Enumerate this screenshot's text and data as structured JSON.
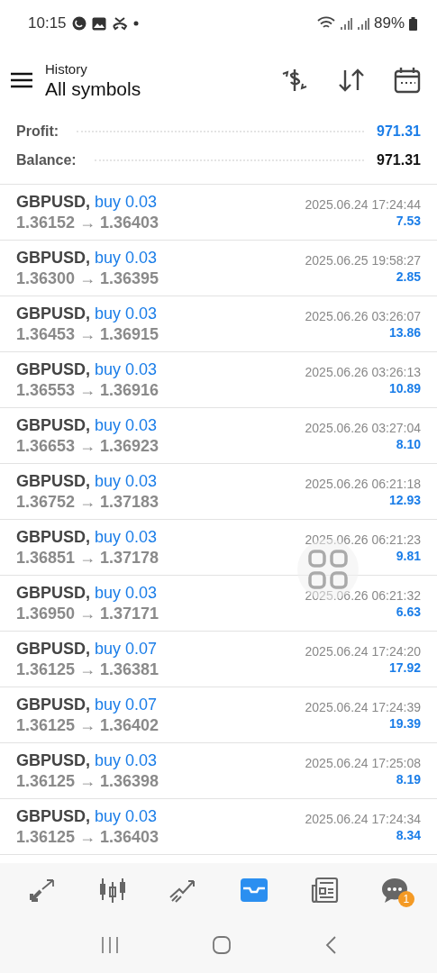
{
  "status_bar": {
    "time": "10:15",
    "battery": "89%"
  },
  "header": {
    "subtitle": "History",
    "title": "All symbols"
  },
  "summary": [
    {
      "label": "Profit:",
      "value": "971.31",
      "kind": "profit"
    },
    {
      "label": "Balance:",
      "value": "971.31",
      "kind": "balance"
    }
  ],
  "deals": [
    {
      "symbol": "GBPUSD,",
      "side": "buy 0.03",
      "prices": "1.36152 → 1.36403",
      "time": "2025.06.24 17:24:44",
      "profit": "7.53"
    },
    {
      "symbol": "GBPUSD,",
      "side": "buy 0.03",
      "prices": "1.36300 → 1.36395",
      "time": "2025.06.25 19:58:27",
      "profit": "2.85"
    },
    {
      "symbol": "GBPUSD,",
      "side": "buy 0.03",
      "prices": "1.36453 → 1.36915",
      "time": "2025.06.26 03:26:07",
      "profit": "13.86"
    },
    {
      "symbol": "GBPUSD,",
      "side": "buy 0.03",
      "prices": "1.36553 → 1.36916",
      "time": "2025.06.26 03:26:13",
      "profit": "10.89"
    },
    {
      "symbol": "GBPUSD,",
      "side": "buy 0.03",
      "prices": "1.36653 → 1.36923",
      "time": "2025.06.26 03:27:04",
      "profit": "8.10"
    },
    {
      "symbol": "GBPUSD,",
      "side": "buy 0.03",
      "prices": "1.36752 → 1.37183",
      "time": "2025.06.26 06:21:18",
      "profit": "12.93"
    },
    {
      "symbol": "GBPUSD,",
      "side": "buy 0.03",
      "prices": "1.36851 → 1.37178",
      "time": "2025.06.26 06:21:23",
      "profit": "9.81"
    },
    {
      "symbol": "GBPUSD,",
      "side": "buy 0.03",
      "prices": "1.36950 → 1.37171",
      "time": "2025.06.26 06:21:32",
      "profit": "6.63"
    },
    {
      "symbol": "GBPUSD,",
      "side": "buy 0.07",
      "prices": "1.36125 → 1.36381",
      "time": "2025.06.24 17:24:20",
      "profit": "17.92"
    },
    {
      "symbol": "GBPUSD,",
      "side": "buy 0.07",
      "prices": "1.36125 → 1.36402",
      "time": "2025.06.24 17:24:39",
      "profit": "19.39"
    },
    {
      "symbol": "GBPUSD,",
      "side": "buy 0.03",
      "prices": "1.36125 → 1.36398",
      "time": "2025.06.24 17:25:08",
      "profit": "8.19"
    },
    {
      "symbol": "GBPUSD,",
      "side": "buy 0.03",
      "prices": "1.36125 → 1.36403",
      "time": "2025.06.24 17:24:34",
      "profit": "8.34"
    }
  ],
  "bottom_nav": [
    {
      "kind": "quotes",
      "selected": false
    },
    {
      "kind": "chart",
      "selected": false
    },
    {
      "kind": "trade",
      "selected": false
    },
    {
      "kind": "history",
      "selected": true
    },
    {
      "kind": "news",
      "selected": false
    },
    {
      "kind": "messages",
      "selected": false,
      "badge": "1"
    }
  ]
}
